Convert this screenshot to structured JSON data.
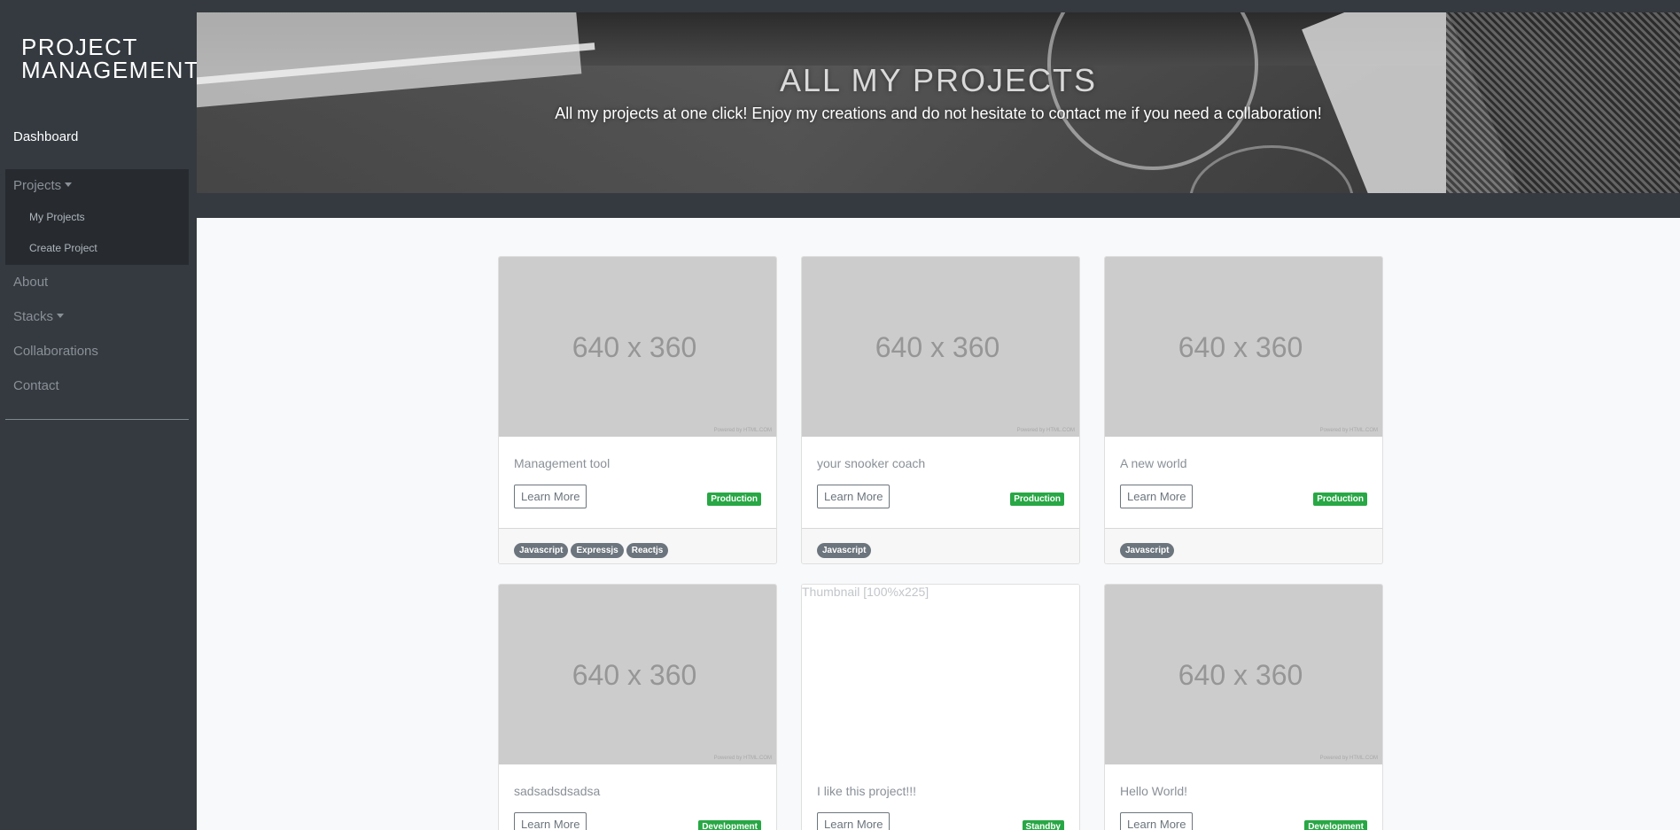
{
  "sidebar": {
    "brand_line1": "PROJECT",
    "brand_line2": "MANAGEMENT",
    "items": {
      "dashboard": "Dashboard",
      "projects": "Projects",
      "my_projects": "My Projects",
      "create_project": "Create Project",
      "about": "About",
      "stacks": "Stacks",
      "collaborations": "Collaborations",
      "contact": "Contact"
    }
  },
  "hero": {
    "title": "ALL MY PROJECTS",
    "subtitle": "All my projects at one click! Enjoy my creations and do not hesitate to contact me if you need a collaboration!"
  },
  "cards": [
    {
      "thumb": "640 x 360",
      "credit": "Powered by HTML.COM",
      "title": "Management tool",
      "button": "Learn More",
      "status": "Production",
      "tags": [
        "Javascript",
        "Expressjs",
        "Reactjs"
      ]
    },
    {
      "thumb": "640 x 360",
      "credit": "Powered by HTML.COM",
      "title": "your snooker coach",
      "button": "Learn More",
      "status": "Production",
      "tags": [
        "Javascript"
      ]
    },
    {
      "thumb": "640 x 360",
      "credit": "Powered by HTML.COM",
      "title": "A new world",
      "button": "Learn More",
      "status": "Production",
      "tags": [
        "Javascript"
      ]
    },
    {
      "thumb": "640 x 360",
      "credit": "Powered by HTML.COM",
      "title": "sadsadsdsadsa",
      "button": "Learn More",
      "status": "Development"
    },
    {
      "alt": "Thumbnail [100%x225]",
      "title": "I like this project!!!",
      "button": "Learn More",
      "status": "Standby"
    },
    {
      "thumb": "640 x 360",
      "credit": "Powered by HTML.COM",
      "title": "Hello World!",
      "button": "Learn More",
      "status": "Development"
    }
  ],
  "colors": {
    "badge": "#28a745",
    "tag": "#6c757d",
    "sidebar": "#343a40"
  }
}
